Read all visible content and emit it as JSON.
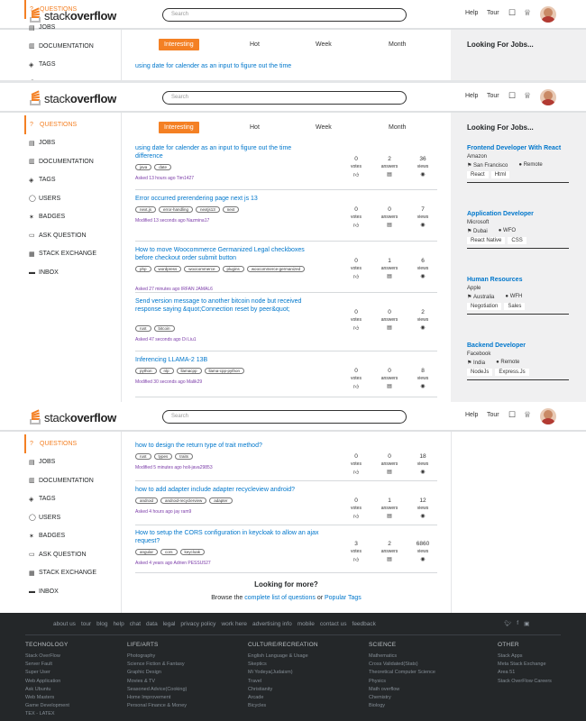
{
  "header": {
    "logo_stack": "stack",
    "logo_overflow": "overflow",
    "search_placeholder": "Search",
    "help": "Help",
    "tour": "Tour"
  },
  "sidebar": {
    "items": [
      {
        "label": "QUESTIONS",
        "icon": "question-icon"
      },
      {
        "label": "JOBS",
        "icon": "briefcase-icon"
      },
      {
        "label": "DOCUMENTATION",
        "icon": "document-icon"
      },
      {
        "label": "TAGS",
        "icon": "tag-icon"
      },
      {
        "label": "USERS",
        "icon": "user-icon"
      },
      {
        "label": "BADGES",
        "icon": "badge-icon"
      },
      {
        "label": "ASK QUESTION",
        "icon": "chat-icon"
      },
      {
        "label": "STACK EXCHANGE",
        "icon": "stack-icon"
      },
      {
        "label": "INBOX",
        "icon": "inbox-icon"
      }
    ]
  },
  "tabs": [
    "Interesting",
    "Hot",
    "Week",
    "Month"
  ],
  "partial_title": "using date for calender as an input to figure out the time",
  "stat_labels": {
    "votes": "votes",
    "answers": "answers",
    "views": "views"
  },
  "questions": [
    {
      "title": "using date for calender as an input to figure out the time difference",
      "tags": [
        "java",
        "date"
      ],
      "meta": "Asked 13 hours ago",
      "user": "Tim1427",
      "votes": "0",
      "answers": "2",
      "views": "36"
    },
    {
      "title": "Error occurred prerendering page next js 13",
      "tags": [
        "next.js",
        "error-handling",
        "nextjs13",
        "next"
      ],
      "meta": "Modified 13 seconds ago",
      "user": "Nazmina17",
      "votes": "0",
      "answers": "0",
      "views": "7"
    },
    {
      "title": "How to move Woocommerce Germanized Legal checkboxes before checkout order submit button",
      "tags": [
        "php",
        "wordpress",
        "woocommerce",
        "plugins",
        "woocommerce-germanized"
      ],
      "meta": "Asked 27 minutes ago",
      "user": "IRFAN JAMAL6",
      "votes": "0",
      "answers": "1",
      "views": "6"
    },
    {
      "title": "Send version message to another bitcoin node but received response saying &quot;Connection reset by peer&quot;",
      "tags": [
        "rust",
        "bitcoin"
      ],
      "meta": "Asked 47 seconds ago",
      "user": "Di Liu1",
      "votes": "0",
      "answers": "0",
      "views": "2"
    },
    {
      "title": "Inferencing LLAMA-2 13B",
      "tags": [
        "python",
        "nlp",
        "llamacpp",
        "llama-cpp-python"
      ],
      "meta": "Modified 30 seconds ago",
      "user": "Malik29",
      "votes": "0",
      "answers": "0",
      "views": "8"
    }
  ],
  "questions_more": [
    {
      "title": "how to design the return type of trait method?",
      "tags": [
        "rust",
        "types",
        "traits"
      ],
      "meta": "Modified 5 minutes ago",
      "user": "holi-java29853",
      "votes": "0",
      "answers": "0",
      "views": "18"
    },
    {
      "title": "how to add adapter include adapter recycleview android?",
      "tags": [
        "android",
        "android-recyclerview",
        "adapter"
      ],
      "meta": "Asked 4 hours ago",
      "user": "jay ram9",
      "votes": "0",
      "answers": "1",
      "views": "12"
    },
    {
      "title": "How to setup the CORS configuration in keycloak to allow an ajax request?",
      "tags": [
        "angular",
        "cors",
        "keycloak"
      ],
      "meta": "Asked 4 years ago",
      "user": "Adrien PESSU527",
      "votes": "3",
      "answers": "2",
      "views": "6860"
    }
  ],
  "jobs_heading": "Looking For Jobs...",
  "jobs": [
    {
      "title": "Frontend Developer With React",
      "company": "Amazon",
      "location": "San Francisco",
      "mode": "Remote",
      "tags": [
        "React",
        "Html"
      ]
    },
    {
      "title": "Application Developer",
      "company": "Microsoft",
      "location": "Dubai",
      "mode": "WFO",
      "tags": [
        "React Native",
        "CSS"
      ]
    },
    {
      "title": "Human Resources",
      "company": "Apple",
      "location": "Australia",
      "mode": "WFH",
      "tags": [
        "Negotiation",
        "Sales"
      ]
    },
    {
      "title": "Backend Developer",
      "company": "Facebook",
      "location": "India",
      "mode": "Remote",
      "tags": [
        "NodeJs",
        "Express.Js"
      ]
    }
  ],
  "more": {
    "heading": "Looking for more?",
    "browse": "Browse the",
    "link1": "complete list of questions",
    "or": "or",
    "link2": "Popular Tags"
  },
  "footer": {
    "links": [
      "about us",
      "tour",
      "blog",
      "help",
      "chat",
      "data",
      "legal",
      "privacy policy",
      "work here",
      "advertising info",
      "mobile",
      "contact us",
      "feedback"
    ],
    "columns": [
      {
        "heading": "TECHNOLOGY",
        "items": [
          "Stack OverFlow",
          "Server Fault",
          "Super User",
          "Web Application",
          "Ask Ubuntu",
          "Web Masters",
          "Game Development",
          "TEX - LATEX"
        ]
      },
      {
        "heading": "LIFE/ARTS",
        "items": [
          "Photography",
          "Science Fiction & Fantasy",
          "Graphic Design",
          "Movies & TV",
          "Seasoned Advice(Cooking)",
          "Home Improvement",
          "Personal Finance & Money"
        ]
      },
      {
        "heading": "CULTURE/RECREATION",
        "items": [
          "English Language & Usage",
          "Skeptics",
          "Mi Yodeya(Judaism)",
          "Travel",
          "Christianity",
          "Arcade",
          "Bicycles"
        ]
      },
      {
        "heading": "SCIENCE",
        "items": [
          "Mathematics",
          "Cross Validated(Stats)",
          "Theoretical Computer Science",
          "Physics",
          "Math overflow",
          "Chemistry",
          "Biology"
        ]
      },
      {
        "heading": "OTHER",
        "items": [
          "Stack Apps",
          "Meta Stack Exchange",
          "Area 51",
          "Stack OverFlow Careers"
        ]
      }
    ]
  }
}
